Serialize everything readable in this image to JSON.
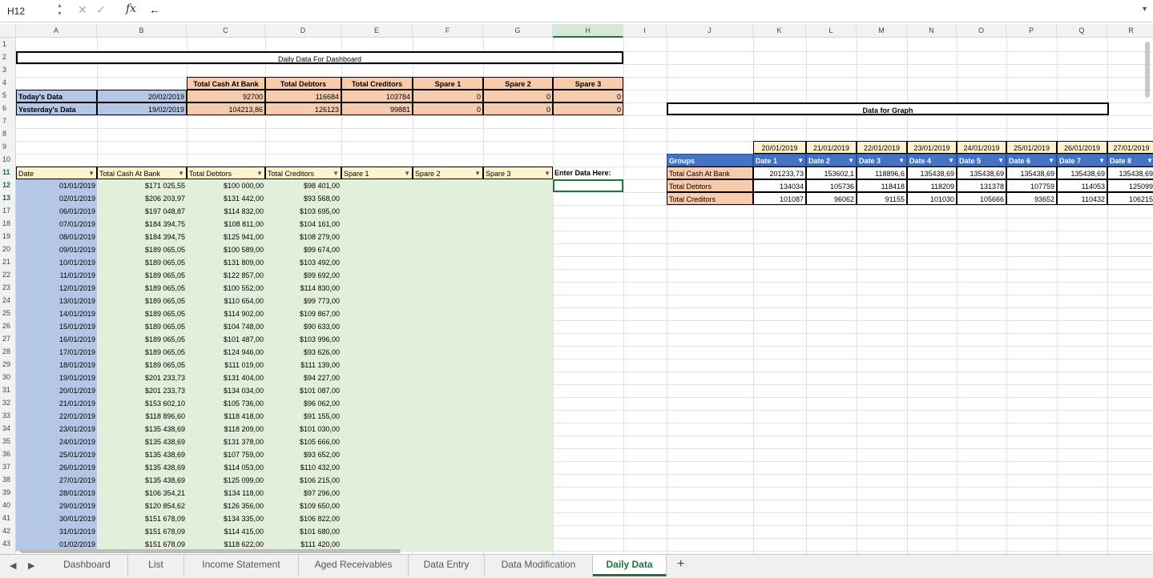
{
  "namebox": "H12",
  "formula": "←",
  "columns": [
    "A",
    "B",
    "C",
    "D",
    "E",
    "F",
    "G",
    "H",
    "I",
    "J",
    "K",
    "L",
    "M",
    "N",
    "O",
    "P",
    "Q",
    "R"
  ],
  "rows": [
    "1",
    "2",
    "3",
    "4",
    "5",
    "6",
    "7",
    "8",
    "9",
    "10",
    "11",
    "12",
    "13",
    "17",
    "18",
    "19",
    "20",
    "21",
    "22",
    "23",
    "24",
    "25",
    "26",
    "27",
    "28",
    "29",
    "30",
    "31",
    "32",
    "33",
    "34",
    "35",
    "36",
    "37",
    "38",
    "39",
    "40",
    "41",
    "42",
    "43"
  ],
  "dashboard": {
    "title": "Daily Data For Dashboard",
    "headers": [
      "Total Cash At Bank",
      "Total Debtors",
      "Total Creditors",
      "Spare 1",
      "Spare 2",
      "Spare 3"
    ],
    "today": {
      "label": "Today's Data",
      "date": "20/02/2019",
      "values": [
        "92700",
        "116684",
        "103784",
        "0",
        "0",
        "0"
      ]
    },
    "yesterday": {
      "label": "Yesterday's Data",
      "date": "19/02/2019",
      "values": [
        "104213,86",
        "126123",
        "99881",
        "0",
        "0",
        "0"
      ]
    }
  },
  "daily": {
    "headers": [
      "Date",
      "Total Cash At Bank",
      "Total Debtors",
      "Total Creditors",
      "Spare 1",
      "Spare 2",
      "Spare 3"
    ],
    "enter_label": "Enter Data Here:",
    "rows": [
      [
        "01/01/2019",
        "$171 025,55",
        "$100 000,00",
        "$98 401,00"
      ],
      [
        "02/01/2019",
        "$206 203,97",
        "$131 442,00",
        "$93 568,00"
      ],
      [
        "06/01/2019",
        "$197 048,87",
        "$114 832,00",
        "$103 695,00"
      ],
      [
        "07/01/2019",
        "$184 394,75",
        "$108 811,00",
        "$104 161,00"
      ],
      [
        "08/01/2019",
        "$184 394,75",
        "$125 941,00",
        "$108 279,00"
      ],
      [
        "09/01/2019",
        "$189 065,05",
        "$100 589,00",
        "$99 674,00"
      ],
      [
        "10/01/2019",
        "$189 065,05",
        "$131 809,00",
        "$103 492,00"
      ],
      [
        "11/01/2019",
        "$189 065,05",
        "$122 857,00",
        "$99 692,00"
      ],
      [
        "12/01/2019",
        "$189 065,05",
        "$100 552,00",
        "$114 830,00"
      ],
      [
        "13/01/2019",
        "$189 065,05",
        "$110 654,00",
        "$99 773,00"
      ],
      [
        "14/01/2019",
        "$189 065,05",
        "$114 902,00",
        "$109 867,00"
      ],
      [
        "15/01/2019",
        "$189 065,05",
        "$104 748,00",
        "$90 633,00"
      ],
      [
        "16/01/2019",
        "$189 065,05",
        "$101 487,00",
        "$103 996,00"
      ],
      [
        "17/01/2019",
        "$189 065,05",
        "$124 946,00",
        "$93 626,00"
      ],
      [
        "18/01/2019",
        "$189 065,05",
        "$111 019,00",
        "$111 139,00"
      ],
      [
        "19/01/2019",
        "$201 233,73",
        "$131 404,00",
        "$94 227,00"
      ],
      [
        "20/01/2019",
        "$201 233,73",
        "$134 034,00",
        "$101 087,00"
      ],
      [
        "21/01/2019",
        "$153 602,10",
        "$105 736,00",
        "$96 062,00"
      ],
      [
        "22/01/2019",
        "$118 896,60",
        "$118 418,00",
        "$91 155,00"
      ],
      [
        "23/01/2019",
        "$135 438,69",
        "$118 209,00",
        "$101 030,00"
      ],
      [
        "24/01/2019",
        "$135 438,69",
        "$131 378,00",
        "$105 666,00"
      ],
      [
        "25/01/2019",
        "$135 438,69",
        "$107 759,00",
        "$93 652,00"
      ],
      [
        "26/01/2019",
        "$135 438,69",
        "$114 053,00",
        "$110 432,00"
      ],
      [
        "27/01/2019",
        "$135 438,69",
        "$125 099,00",
        "$106 215,00"
      ],
      [
        "28/01/2019",
        "$106 354,21",
        "$134 118,00",
        "$97 296,00"
      ],
      [
        "29/01/2019",
        "$120 854,62",
        "$126 356,00",
        "$109 650,00"
      ],
      [
        "30/01/2019",
        "$151 678,09",
        "$134 335,00",
        "$106 822,00"
      ],
      [
        "31/01/2019",
        "$151 678,09",
        "$114 415,00",
        "$101 680,00"
      ],
      [
        "01/02/2019",
        "$151 678,09",
        "$118 622,00",
        "$111 420,00"
      ]
    ]
  },
  "graph": {
    "title": "Data for Graph",
    "dates": [
      "20/01/2019",
      "21/01/2019",
      "22/01/2019",
      "23/01/2019",
      "24/01/2019",
      "25/01/2019",
      "26/01/2019",
      "27/01/2019"
    ],
    "groups_label": "Groups",
    "date_headers": [
      "Date 1",
      "Date 2",
      "Date 3",
      "Date 4",
      "Date 5",
      "Date 6",
      "Date 7",
      "Date 8"
    ],
    "rows": [
      {
        "label": "Total Cash At Bank",
        "values": [
          "201233,73",
          "153602,1",
          "118896,6",
          "135438,69",
          "135438,69",
          "135438,69",
          "135438,69",
          "135438,69"
        ]
      },
      {
        "label": "Total Debtors",
        "values": [
          "134034",
          "105736",
          "118418",
          "118209",
          "131378",
          "107759",
          "114053",
          "125099"
        ]
      },
      {
        "label": "Total Creditors",
        "values": [
          "101087",
          "96062",
          "91155",
          "101030",
          "105666",
          "93652",
          "110432",
          "106215"
        ]
      }
    ]
  },
  "tabs": [
    "Dashboard",
    "List",
    "Income Statement",
    "Aged Receivables",
    "Data Entry",
    "Data Modification",
    "Daily Data"
  ],
  "active_tab": "Daily Data",
  "colors": {
    "accent": "#217346",
    "blue_cell": "#b4c7e7",
    "salmon": "#f8cbad",
    "green_cell": "#e2efda",
    "yellow": "#fff2cc",
    "table_header": "#4472c4"
  }
}
